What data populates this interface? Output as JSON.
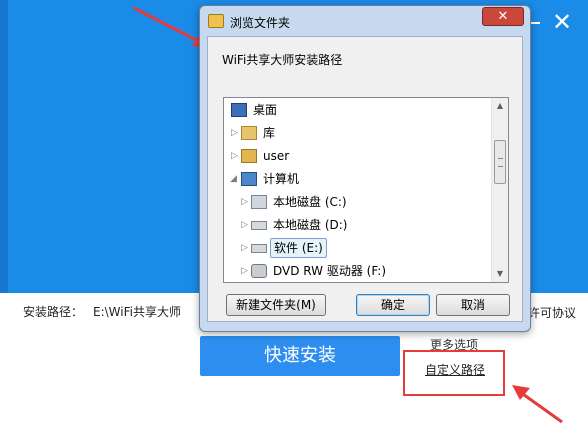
{
  "installer": {
    "close_glyph": "✕",
    "install_path_label": "安装路径：",
    "install_path_value": "E:\\WiFi共享大师",
    "license_text": "许可协议",
    "quick_install_label": "快速安装",
    "more_options_label": "更多选项",
    "custom_path_label": "自定义路径"
  },
  "dialog": {
    "title": "浏览文件夹",
    "close_glyph": "✕",
    "description": "WiFi共享大师安装路径",
    "tree": [
      {
        "label": "桌面",
        "icon": "desktop-icon",
        "expander": ""
      },
      {
        "label": "库",
        "icon": "library-icon",
        "expander": "▷"
      },
      {
        "label": "user",
        "icon": "user-folder-icon",
        "expander": "▷"
      },
      {
        "label": "计算机",
        "icon": "computer-icon",
        "expander": "◢"
      },
      {
        "label": "本地磁盘 (C:)",
        "icon": "system-drive-icon",
        "expander": "▷"
      },
      {
        "label": "本地磁盘 (D:)",
        "icon": "drive-icon",
        "expander": "▷"
      },
      {
        "label": "软件 (E:)",
        "icon": "drive-icon",
        "expander": "▷",
        "selected": true
      },
      {
        "label": "DVD RW 驱动器 (F:)",
        "icon": "dvd-drive-icon",
        "expander": "▷"
      }
    ],
    "new_folder_label": "新建文件夹(M)",
    "ok_label": "确定",
    "cancel_label": "取消"
  },
  "colors": {
    "installer_blue": "#1a8be6",
    "button_blue": "#2d8ef0",
    "highlight_red": "#e53b3b"
  }
}
